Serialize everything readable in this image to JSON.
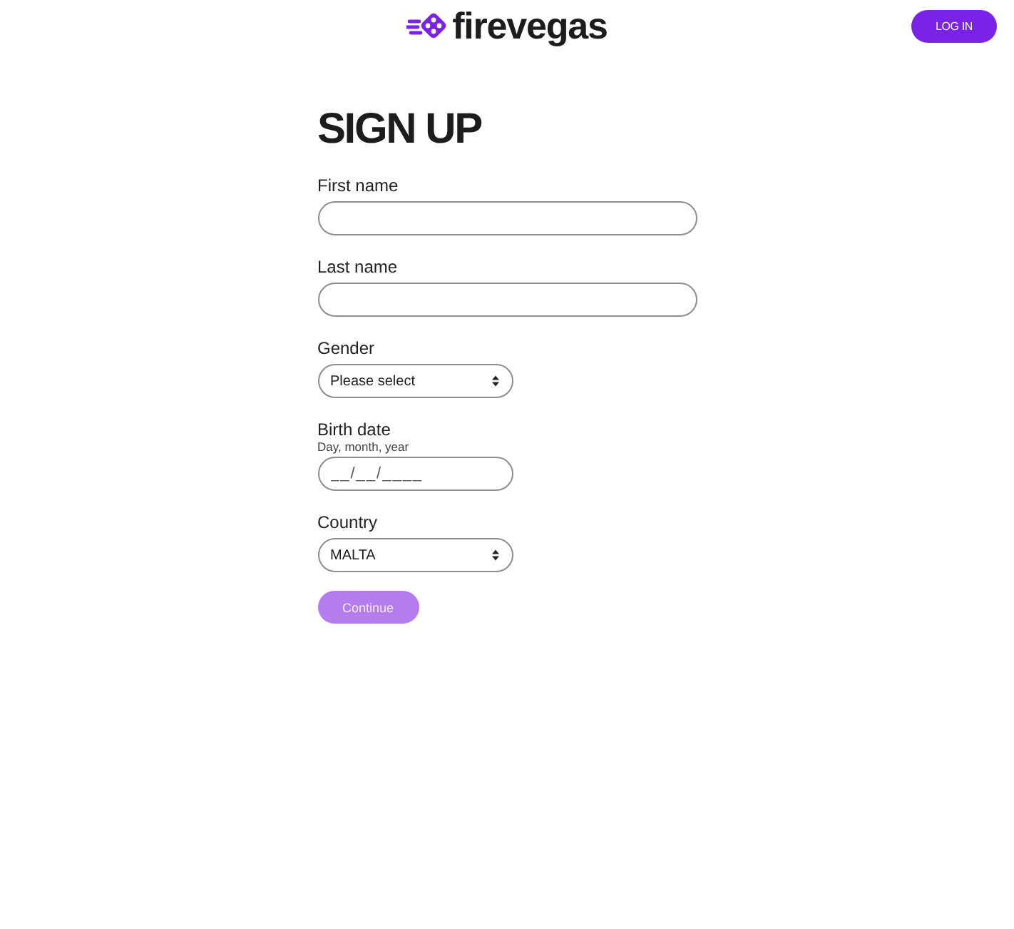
{
  "header": {
    "logo_text": "firevegas",
    "login_button": "LOG IN"
  },
  "form": {
    "title": "SIGN UP",
    "fields": [
      {
        "kind": "text",
        "label": "First name"
      },
      {
        "kind": "text",
        "label": "Last name"
      },
      {
        "kind": "select",
        "label": "Gender",
        "value": "Please select"
      },
      {
        "kind": "date",
        "label": "Birth date",
        "hint": "Day, month, year",
        "placeholder": "__/__/____"
      },
      {
        "kind": "select",
        "label": "Country",
        "value": "MALTA"
      }
    ],
    "continue_button": {
      "label": "Continue",
      "disabled": true
    }
  }
}
